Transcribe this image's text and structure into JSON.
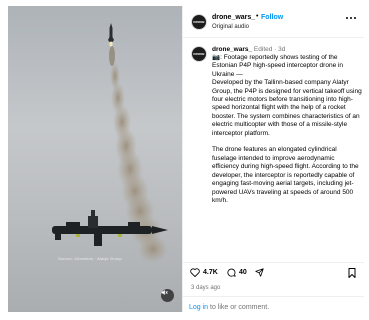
{
  "header": {
    "username": "drone_wars_",
    "separator": "•",
    "follow_label": "Follow",
    "audio_label": "Original audio"
  },
  "caption": {
    "username": "drone_wars_",
    "meta": "Edited · 3d",
    "text": "📷: Footage reportedly shows testing of the Estonian P4P high-speed interceptor drone in Ukraine —\nDeveloped by the Tallinn-based company Alatyr Group, the P4P is designed for vertical takeoff using four electric motors before transitioning into high-speed horizontal flight with the help of a rocket booster. The system combines characteristics of an electric multicopter with those of a missile-style interceptor platform.\n\nThe drone features an elongated cylindrical fuselage intended to improve aerodynamic efficiency during high-speed flight. According to the developer, the interceptor is reportedly capable of engaging fast-moving aerial targets, including jet-powered UAVs traveling at speeds of around 500 km/h."
  },
  "actions": {
    "likes": "4.7K",
    "comments": "40",
    "time_ago": "3 days ago"
  },
  "footer": {
    "login_link": "Log in",
    "login_rest": " to like or comment."
  },
  "media": {
    "watermark": "Source: Ukrainian · Alatyr Group"
  },
  "icons": {
    "avatar": "avatar-icon",
    "more": "more-options-icon",
    "heart": "heart-icon",
    "comment": "comment-icon",
    "share": "share-icon",
    "bookmark": "bookmark-icon",
    "mute": "mute-icon"
  },
  "colors": {
    "link": "#0095f6",
    "muted": "#737373",
    "border": "#efefef"
  }
}
